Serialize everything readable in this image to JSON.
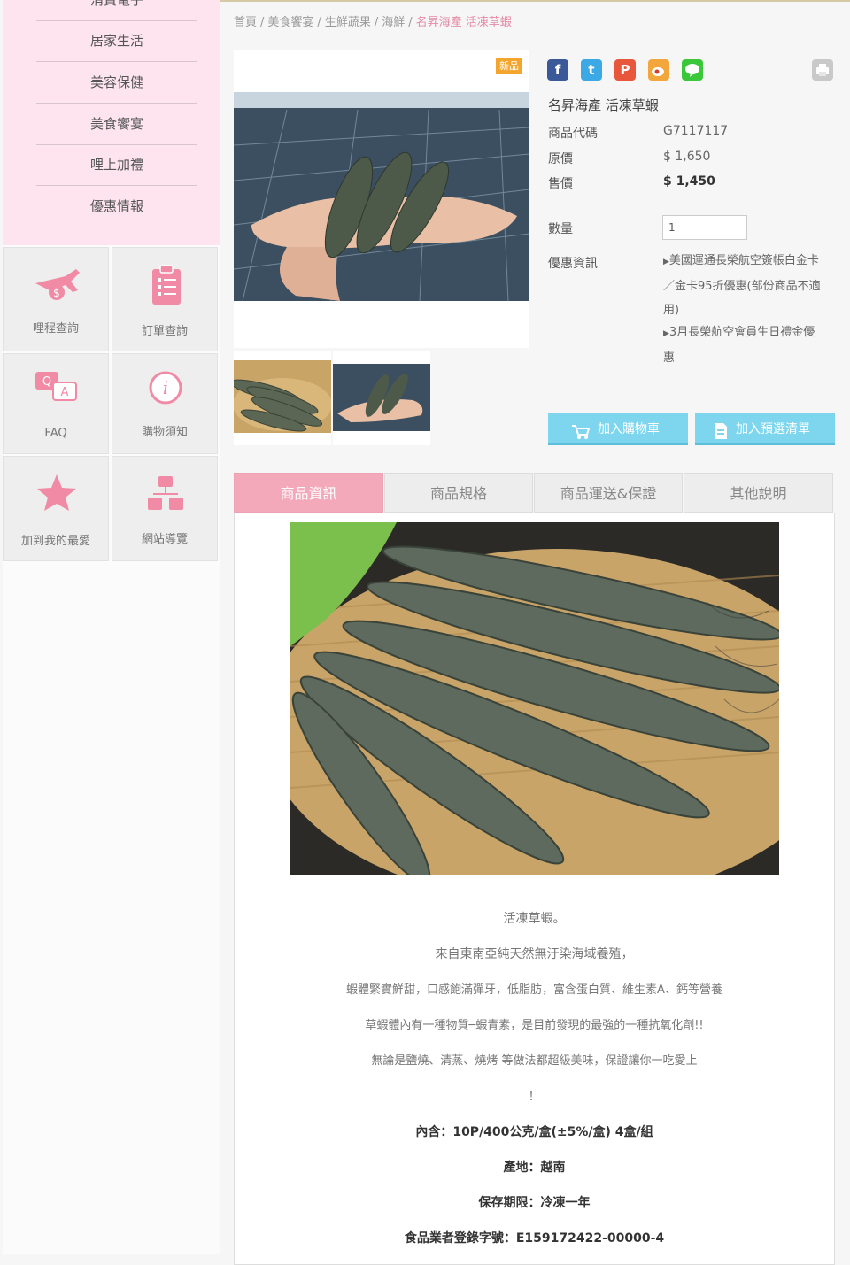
{
  "sidebar": {
    "menu": [
      "消費電子",
      "居家生活",
      "美容保健",
      "美食饗宴",
      "哩上加禮",
      "優惠情報"
    ],
    "tiles": [
      {
        "label": "哩程查詢",
        "icon": "plane-coin-icon"
      },
      {
        "label": "訂單查詢",
        "icon": "clipboard-list-icon"
      },
      {
        "label": "FAQ",
        "icon": "qa-chat-icon"
      },
      {
        "label": "購物須知",
        "icon": "info-icon"
      },
      {
        "label": "加到我的最愛",
        "icon": "star-icon"
      },
      {
        "label": "網站導覽",
        "icon": "sitemap-icon"
      }
    ]
  },
  "breadcrumb": {
    "items": [
      "首頁",
      "美食饗宴",
      "生鮮蔬果",
      "海鮮"
    ],
    "current": "名昇海產 活凍草蝦",
    "separator": "/"
  },
  "product": {
    "badge": "新品",
    "name": "名昇海產 活凍草蝦",
    "code_label": "商品代碼",
    "code": "G7117117",
    "list_price_label": "原價",
    "list_price": "$ 1,650",
    "sale_price_label": "售價",
    "sale_price": "$ 1,450",
    "qty_label": "數量",
    "qty_value": "1",
    "promo_label": "優惠資訊",
    "promo_1_line1": "美國運通長榮航空簽帳白金卡",
    "promo_1_line2": "／金卡95折優惠(部份商品不適",
    "promo_1_line3": "用)",
    "promo_2_line1": "3月長榮航空會員生日禮金優",
    "promo_2_line2": "惠",
    "add_to_cart": "加入購物車",
    "add_to_wishlist": "加入預選清單"
  },
  "share": {
    "icons": [
      "facebook-icon",
      "twitter-icon",
      "plurk-icon",
      "weibo-icon",
      "line-icon",
      "print-icon"
    ]
  },
  "tabs": [
    "商品資訊",
    "商品規格",
    "商品運送&保證",
    "其他說明"
  ],
  "description": {
    "lines": [
      "活凍草蝦。",
      "來自東南亞純天然無汙染海域養殖，",
      "蝦體緊實鮮甜，口感飽滿彈牙，低脂肪，富含蛋白質、維生素A、鈣等營養",
      "草蝦體內有一種物質─蝦青素，是目前發現的最強的一種抗氧化劑!!",
      "無論是鹽燒、清蒸、燒烤 等做法都超級美味，保證讓你一吃愛上",
      "！"
    ],
    "bold_lines": [
      "內含：10P/400公克/盒(±5%/盒) 4盒/組",
      "產地：越南",
      "保存期限：冷凍一年",
      "食品業者登錄字號：E159172422-00000-4"
    ]
  },
  "colors": {
    "menu_bg": "#fde4ee",
    "accent_pink": "#f4a9bb",
    "button_blue": "#7dd6ee",
    "badge_orange": "#f4a52e"
  }
}
